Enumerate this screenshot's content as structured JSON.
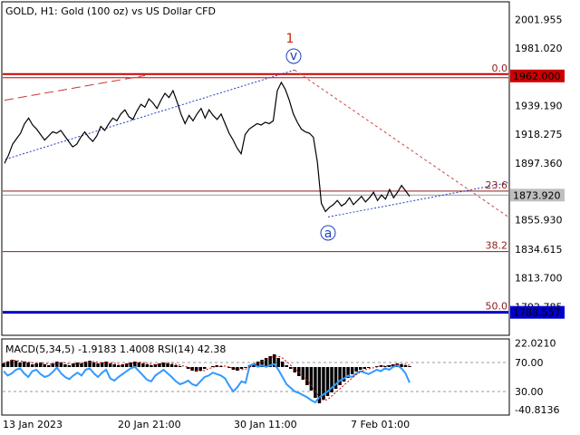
{
  "header": {
    "symbol_info": "GOLD, H1:  Gold (100 oz) vs US Dollar CFD"
  },
  "indicator_header": "MACD(5,34,5) -1.9183 1.4008 RSI(14) 42.38",
  "colors": {
    "price": "#000000",
    "red_line": "#cc0000",
    "fib_line": "#8b1a1a",
    "blue_line": "#0000cc",
    "channel_blue": "#1f3fbf",
    "macd_fill": "#000000",
    "rsi_line": "#3399ff",
    "signal_line": "#cc0000",
    "current_price_bg": "#bfbfbf"
  },
  "chart_data": {
    "type": "line",
    "main": {
      "ylim": [
        1772.5,
        2014
      ],
      "y_ticks": [
        "2001.955",
        "1981.020",
        "1939.190",
        "1918.275",
        "1897.360",
        "1855.930",
        "1834.615",
        "1813.700",
        "1792.785"
      ],
      "x_ticks": [
        "13 Jan 2023",
        "20 Jan 21:00",
        "30 Jan 11:00",
        "7 Feb 01:00"
      ],
      "price_path_close": [
        1897,
        1903,
        1911,
        1915,
        1919,
        1926,
        1930,
        1925,
        1922,
        1918,
        1914,
        1917,
        1920,
        1919,
        1921,
        1917,
        1913,
        1909,
        1911,
        1916,
        1920,
        1916,
        1913,
        1917,
        1924,
        1921,
        1926,
        1930,
        1928,
        1933,
        1936,
        1931,
        1929,
        1935,
        1940,
        1938,
        1944,
        1941,
        1937,
        1943,
        1948,
        1945,
        1950,
        1942,
        1933,
        1926,
        1932,
        1928,
        1933,
        1937,
        1930,
        1936,
        1932,
        1929,
        1933,
        1926,
        1919,
        1914,
        1908,
        1904,
        1918,
        1922,
        1924,
        1926,
        1925,
        1927,
        1926,
        1928,
        1950,
        1956,
        1951,
        1943,
        1933,
        1927,
        1922,
        1920,
        1919,
        1916,
        1898,
        1868,
        1862,
        1865,
        1867,
        1870,
        1866,
        1868,
        1872,
        1867,
        1870,
        1873,
        1869,
        1872,
        1876,
        1870,
        1874,
        1871,
        1878,
        1872,
        1876,
        1881,
        1877,
        1873
      ],
      "current_price": "1873.920",
      "current_price_value": 1873.92,
      "red_level_label": "1962.000",
      "red_level_value": 1962,
      "blue_level_label": "1788.557",
      "blue_level_value": 1788.557,
      "fib_levels": [
        {
          "label": "0.0",
          "value": 1962
        },
        {
          "label": "23.6",
          "value": 1876.8
        },
        {
          "label": "38.2",
          "value": 1832.8
        },
        {
          "label": "50.0",
          "value": 1788.557
        }
      ],
      "wave_labels": [
        {
          "text": "1",
          "color": "#cc2200"
        },
        {
          "text": "v",
          "color": "#1f3fbf"
        },
        {
          "text": "a",
          "color": "#1f3fbf"
        }
      ]
    },
    "indicator": {
      "ylim": [
        -45,
        25
      ],
      "y_ticks": [
        "22.0210",
        "70.00",
        "30.00",
        "-40.8136"
      ],
      "rsi_levels": [
        70,
        30
      ],
      "macd_values": [
        4,
        6,
        8,
        7,
        5,
        6,
        5,
        3,
        4,
        5,
        3,
        2,
        4,
        6,
        5,
        3,
        2,
        4,
        5,
        4,
        6,
        7,
        5,
        4,
        5,
        6,
        4,
        3,
        2,
        3,
        4,
        5,
        6,
        5,
        4,
        3,
        2,
        3,
        4,
        5,
        4,
        3,
        2,
        1,
        0,
        -2,
        -4,
        -5,
        -4,
        -2,
        0,
        1,
        2,
        1,
        0,
        -1,
        -3,
        -4,
        -2,
        -1,
        2,
        4,
        6,
        8,
        10,
        12,
        14,
        10,
        6,
        2,
        -2,
        -6,
        -10,
        -14,
        -20,
        -26,
        -34,
        -40,
        -36,
        -32,
        -28,
        -24,
        -20,
        -16,
        -12,
        -8,
        -5,
        -3,
        -2,
        -1,
        0,
        1,
        2,
        1,
        2,
        3,
        4,
        3,
        2,
        1
      ],
      "rsi_values": [
        58,
        52,
        55,
        60,
        62,
        55,
        50,
        58,
        60,
        54,
        50,
        52,
        57,
        63,
        55,
        50,
        47,
        52,
        56,
        52,
        60,
        62,
        55,
        50,
        56,
        60,
        48,
        45,
        50,
        54,
        58,
        62,
        64,
        58,
        52,
        46,
        44,
        52,
        56,
        60,
        55,
        50,
        44,
        40,
        42,
        45,
        40,
        38,
        44,
        50,
        52,
        56,
        54,
        52,
        48,
        38,
        30,
        36,
        44,
        42,
        66,
        68,
        64,
        66,
        64,
        66,
        68,
        60,
        50,
        40,
        35,
        30,
        28,
        25,
        22,
        18,
        15,
        22,
        26,
        30,
        35,
        40,
        45,
        48,
        52,
        50,
        55,
        58,
        56,
        54,
        57,
        60,
        58,
        62,
        60,
        64,
        66,
        62,
        55,
        42
      ]
    }
  }
}
